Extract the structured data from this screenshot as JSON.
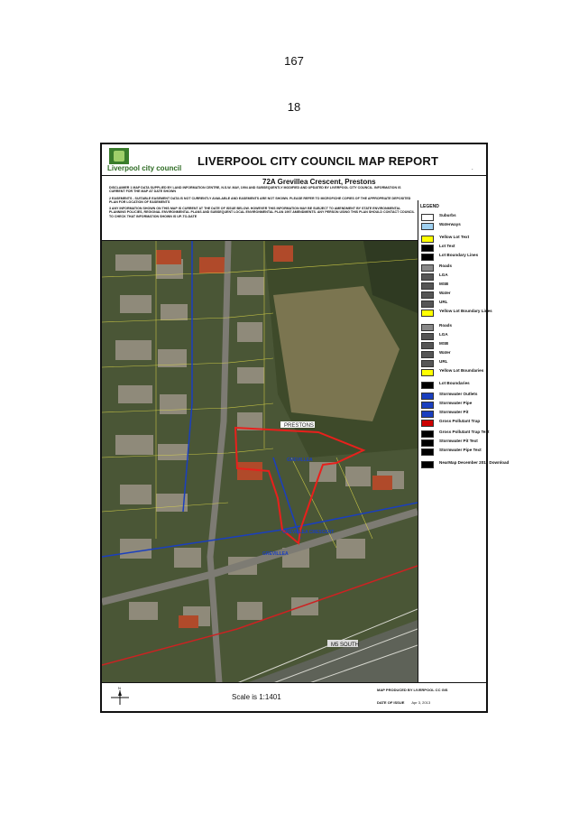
{
  "page": {
    "number_top": "167",
    "number_sub": "18"
  },
  "report": {
    "logo_text": "Liverpool city council",
    "logo_tagline": "",
    "title": "LIVERPOOL CITY COUNCIL MAP REPORT",
    "address": "72A Grevillea Crescent, Prestons",
    "disclaimer": [
      "DISCLAIMER 1 MAP DATA SUPPLIED BY LAND INFORMATION CENTRE, N.S.W. MAY, 1994 AND SUBSEQUENTLY MODIFIED AND UPDATED BY LIVERPOOL CITY COUNCIL. INFORMATION IS CURRENT FOR THE MAP AT DATE SHOWN",
      "2 EASEMENTS - SUITABLE EASEMENT DATA IS NOT CURRENTLY AVAILABLE AND EASEMENTS ARE NOT SHOWN. PLEASE REFER TO MICROFICHE COPIES OF THE APPROPRIATE DEPOSITED PLAN FOR LOCATION OF EASEMENTS",
      "3 ANY INFORMATION SHOWN ON THIS MAP IS CURRENT AT THE DATE OF ISSUE BELOW. HOWEVER THIS INFORMATION MAY BE SUBJECT TO AMENDMENT BY STATE ENVIRONMENTAL PLANNING POLICIES, REGIONAL ENVIRONMENTAL PLANS AND SUBSEQUENT LOCAL ENVIRONMENTAL PLAN 1997 AMENDMENTS. ANY PERSON USING THIS PLAN SHOULD CONTACT COUNCIL TO CHECK THAT INFORMATION SHOWN IS UP-TO-DATE"
    ],
    "map_labels": {
      "suburb": "PRESTONS",
      "street1": "GREVILLEA",
      "street2": "GREVILLEA CRESCENT",
      "street3": "GREVILLEA",
      "motorway": "M5 SOUTH"
    },
    "legend": {
      "heading": "LEGEND",
      "items": [
        {
          "label": "Suburbs",
          "color": "#ffffff"
        },
        {
          "label": "Waterways",
          "color": "#9fd0f0"
        },
        {
          "label": "Yellow Lot Text",
          "color": "#ffff00"
        },
        {
          "label": "Lot Text",
          "color": "#000000"
        },
        {
          "label": "Lot Boundary Lines",
          "color": "#000000"
        },
        {
          "label": "Roads",
          "color": "#888888"
        },
        {
          "label": "LGA",
          "color": "#555555"
        },
        {
          "label": "MSB",
          "color": "#555555"
        },
        {
          "label": "Water",
          "color": "#555555"
        },
        {
          "label": "URL",
          "color": "#555555"
        },
        {
          "label": "Yellow Lot Boundary Lines",
          "color": "#ffff00"
        },
        {
          "label": "Roads",
          "color": "#888888"
        },
        {
          "label": "LGA",
          "color": "#555555"
        },
        {
          "label": "MSB",
          "color": "#555555"
        },
        {
          "label": "Water",
          "color": "#555555"
        },
        {
          "label": "URL",
          "color": "#555555"
        },
        {
          "label": "Yellow Lot Boundaries",
          "color": "#ffff00"
        },
        {
          "label": "Lot Boundaries",
          "color": "#000000"
        },
        {
          "label": "Stormwater Outlets",
          "color": "#1a3fbf"
        },
        {
          "label": "Stormwater Pipe",
          "color": "#1a3fbf"
        },
        {
          "label": "Stormwater Pit",
          "color": "#1a3fbf"
        },
        {
          "label": "Gross Pollutant Trap",
          "color": "#cc0000"
        },
        {
          "label": "Gross Pollutant Trap Text",
          "color": "#000000"
        },
        {
          "label": "Stormwater Pit Text",
          "color": "#000000"
        },
        {
          "label": "Stormwater Pipe Text",
          "color": "#000000"
        },
        {
          "label": "NearMap December 2011 Download",
          "color": "#000000"
        }
      ]
    },
    "north": "N",
    "scale": "Scale is 1:1401",
    "produced_by": "MAP PRODUCED BY LIVERPOOL CC GIS",
    "date_label": "DATE OF ISSUE",
    "date_value": "Apr 3, 2013"
  }
}
